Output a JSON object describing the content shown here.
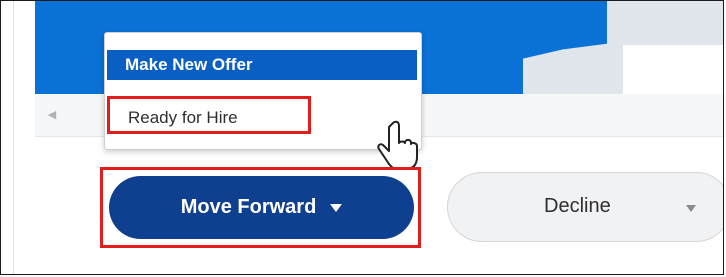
{
  "menu": {
    "items": [
      {
        "label": "Make New Offer"
      },
      {
        "label": "Ready for Hire"
      }
    ]
  },
  "actions": {
    "move_forward": "Move Forward",
    "decline": "Decline"
  },
  "colors": {
    "blue_bar": "#0a72d6",
    "selected_item": "#0a5fc2",
    "primary_button": "#0f3f8f",
    "highlight_border": "#e31c1c"
  },
  "icons": [
    "chevron-left-icon",
    "dropdown-caret-icon",
    "hand-pointer-icon"
  ]
}
